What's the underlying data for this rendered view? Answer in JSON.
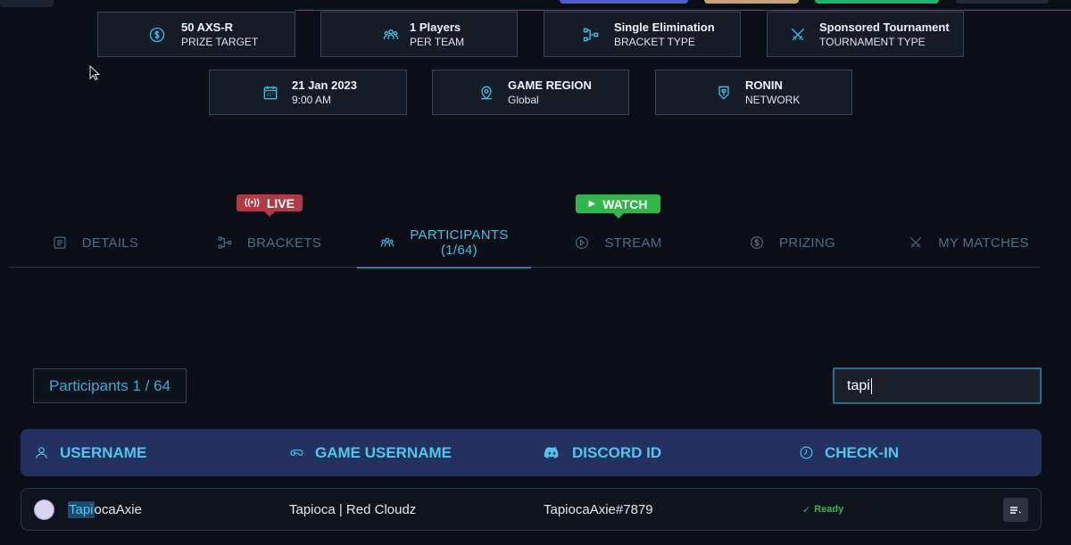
{
  "info_cards": [
    {
      "title": "50 AXS-R",
      "subtitle": "PRIZE TARGET",
      "icon": "prize-coin-icon"
    },
    {
      "title": "1 Players",
      "subtitle": "PER TEAM",
      "icon": "team-icon"
    },
    {
      "title": "Single Elimination",
      "subtitle": "BRACKET TYPE",
      "icon": "bracket-icon"
    },
    {
      "title": "Sponsored Tournament",
      "subtitle": "TOURNAMENT TYPE",
      "icon": "crossed-swords-icon"
    },
    {
      "title": "21 Jan 2023",
      "subtitle": "9:00 AM",
      "icon": "calendar-icon"
    },
    {
      "title": "GAME REGION",
      "subtitle": "Global",
      "icon": "location-pin-icon"
    },
    {
      "title": "RONIN",
      "subtitle": "NETWORK",
      "icon": "ronin-shield-icon"
    }
  ],
  "badges": {
    "live": "LIVE",
    "watch": "WATCH"
  },
  "tabs": [
    {
      "label": "DETAILS",
      "icon": "document-icon"
    },
    {
      "label": "BRACKETS",
      "icon": "bracket-icon"
    },
    {
      "label": "PARTICIPANTS",
      "label_line2": "(1/64)",
      "icon": "team-icon",
      "active": true
    },
    {
      "label": "STREAM",
      "icon": "play-circle-icon"
    },
    {
      "label": "PRIZING",
      "icon": "prize-coin-icon"
    },
    {
      "label": "MY MATCHES",
      "icon": "crossed-swords-icon"
    }
  ],
  "participants_count": "Participants 1 / 64",
  "search": {
    "value": "tapi"
  },
  "table": {
    "columns": [
      {
        "label": "USERNAME",
        "icon": "user-icon"
      },
      {
        "label": "GAME USERNAME",
        "icon": "gamepad-icon"
      },
      {
        "label": "DISCORD ID",
        "icon": "discord-icon"
      },
      {
        "label": "CHECK-IN",
        "icon": "clock-icon"
      }
    ],
    "rows": [
      {
        "username_match": "Tapi",
        "username_rest": "ocaAxie",
        "game_username": "Tapioca | Red Cloudz",
        "discord_id": "TapiocaAxie#7879",
        "check_in": "Ready"
      }
    ]
  },
  "colors": {
    "background": "#0b0e17",
    "accent": "#3fc1e6",
    "live": "#b23946",
    "watch": "#2fb74b",
    "table_header": "#223160",
    "ready": "#3bb44a"
  }
}
